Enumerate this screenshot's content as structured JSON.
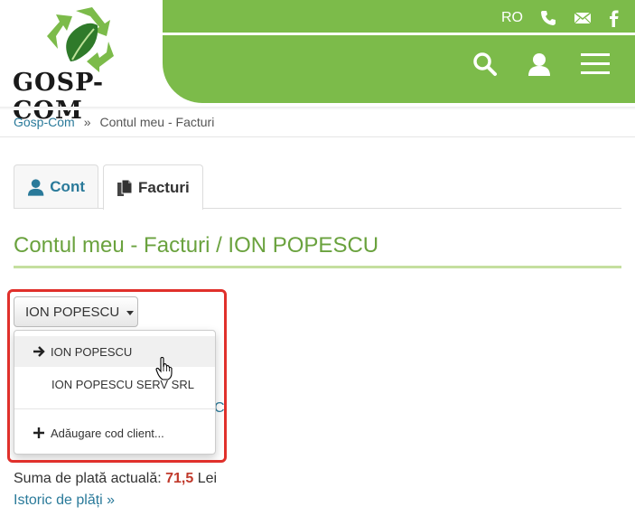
{
  "brand": {
    "name": "GOSP-COM"
  },
  "topbar": {
    "lang": "RO"
  },
  "icons": {
    "phone": "phone-icon",
    "mail": "mail-icon",
    "facebook": "facebook-icon",
    "search": "search-icon",
    "user": "user-icon",
    "menu": "hamburger-menu-icon"
  },
  "colors": {
    "green": "#7cbb4a",
    "title_green": "#6aa23e",
    "link": "#2a7a9a",
    "amount_red": "#c0392b",
    "highlight_red": "#e0302b"
  },
  "breadcrumb": {
    "home": "Gosp-Com",
    "separator": "»",
    "current": "Contul meu - Facturi"
  },
  "tabs": [
    {
      "label": "Cont"
    },
    {
      "label": "Facturi"
    }
  ],
  "page": {
    "title": "Contul meu - Facturi / ION POPESCU"
  },
  "client_dropdown": {
    "selected": "ION POPESCU",
    "options": [
      "ION POPESCU",
      "ION POPESCU SERV SRL"
    ],
    "add_label": "Adăugare cod client...",
    "behind_char": "C"
  },
  "summary": {
    "label": "Suma de plată actuală:",
    "amount": "71,5",
    "currency": "Lei",
    "history_link": "Istoric de plăți »"
  }
}
